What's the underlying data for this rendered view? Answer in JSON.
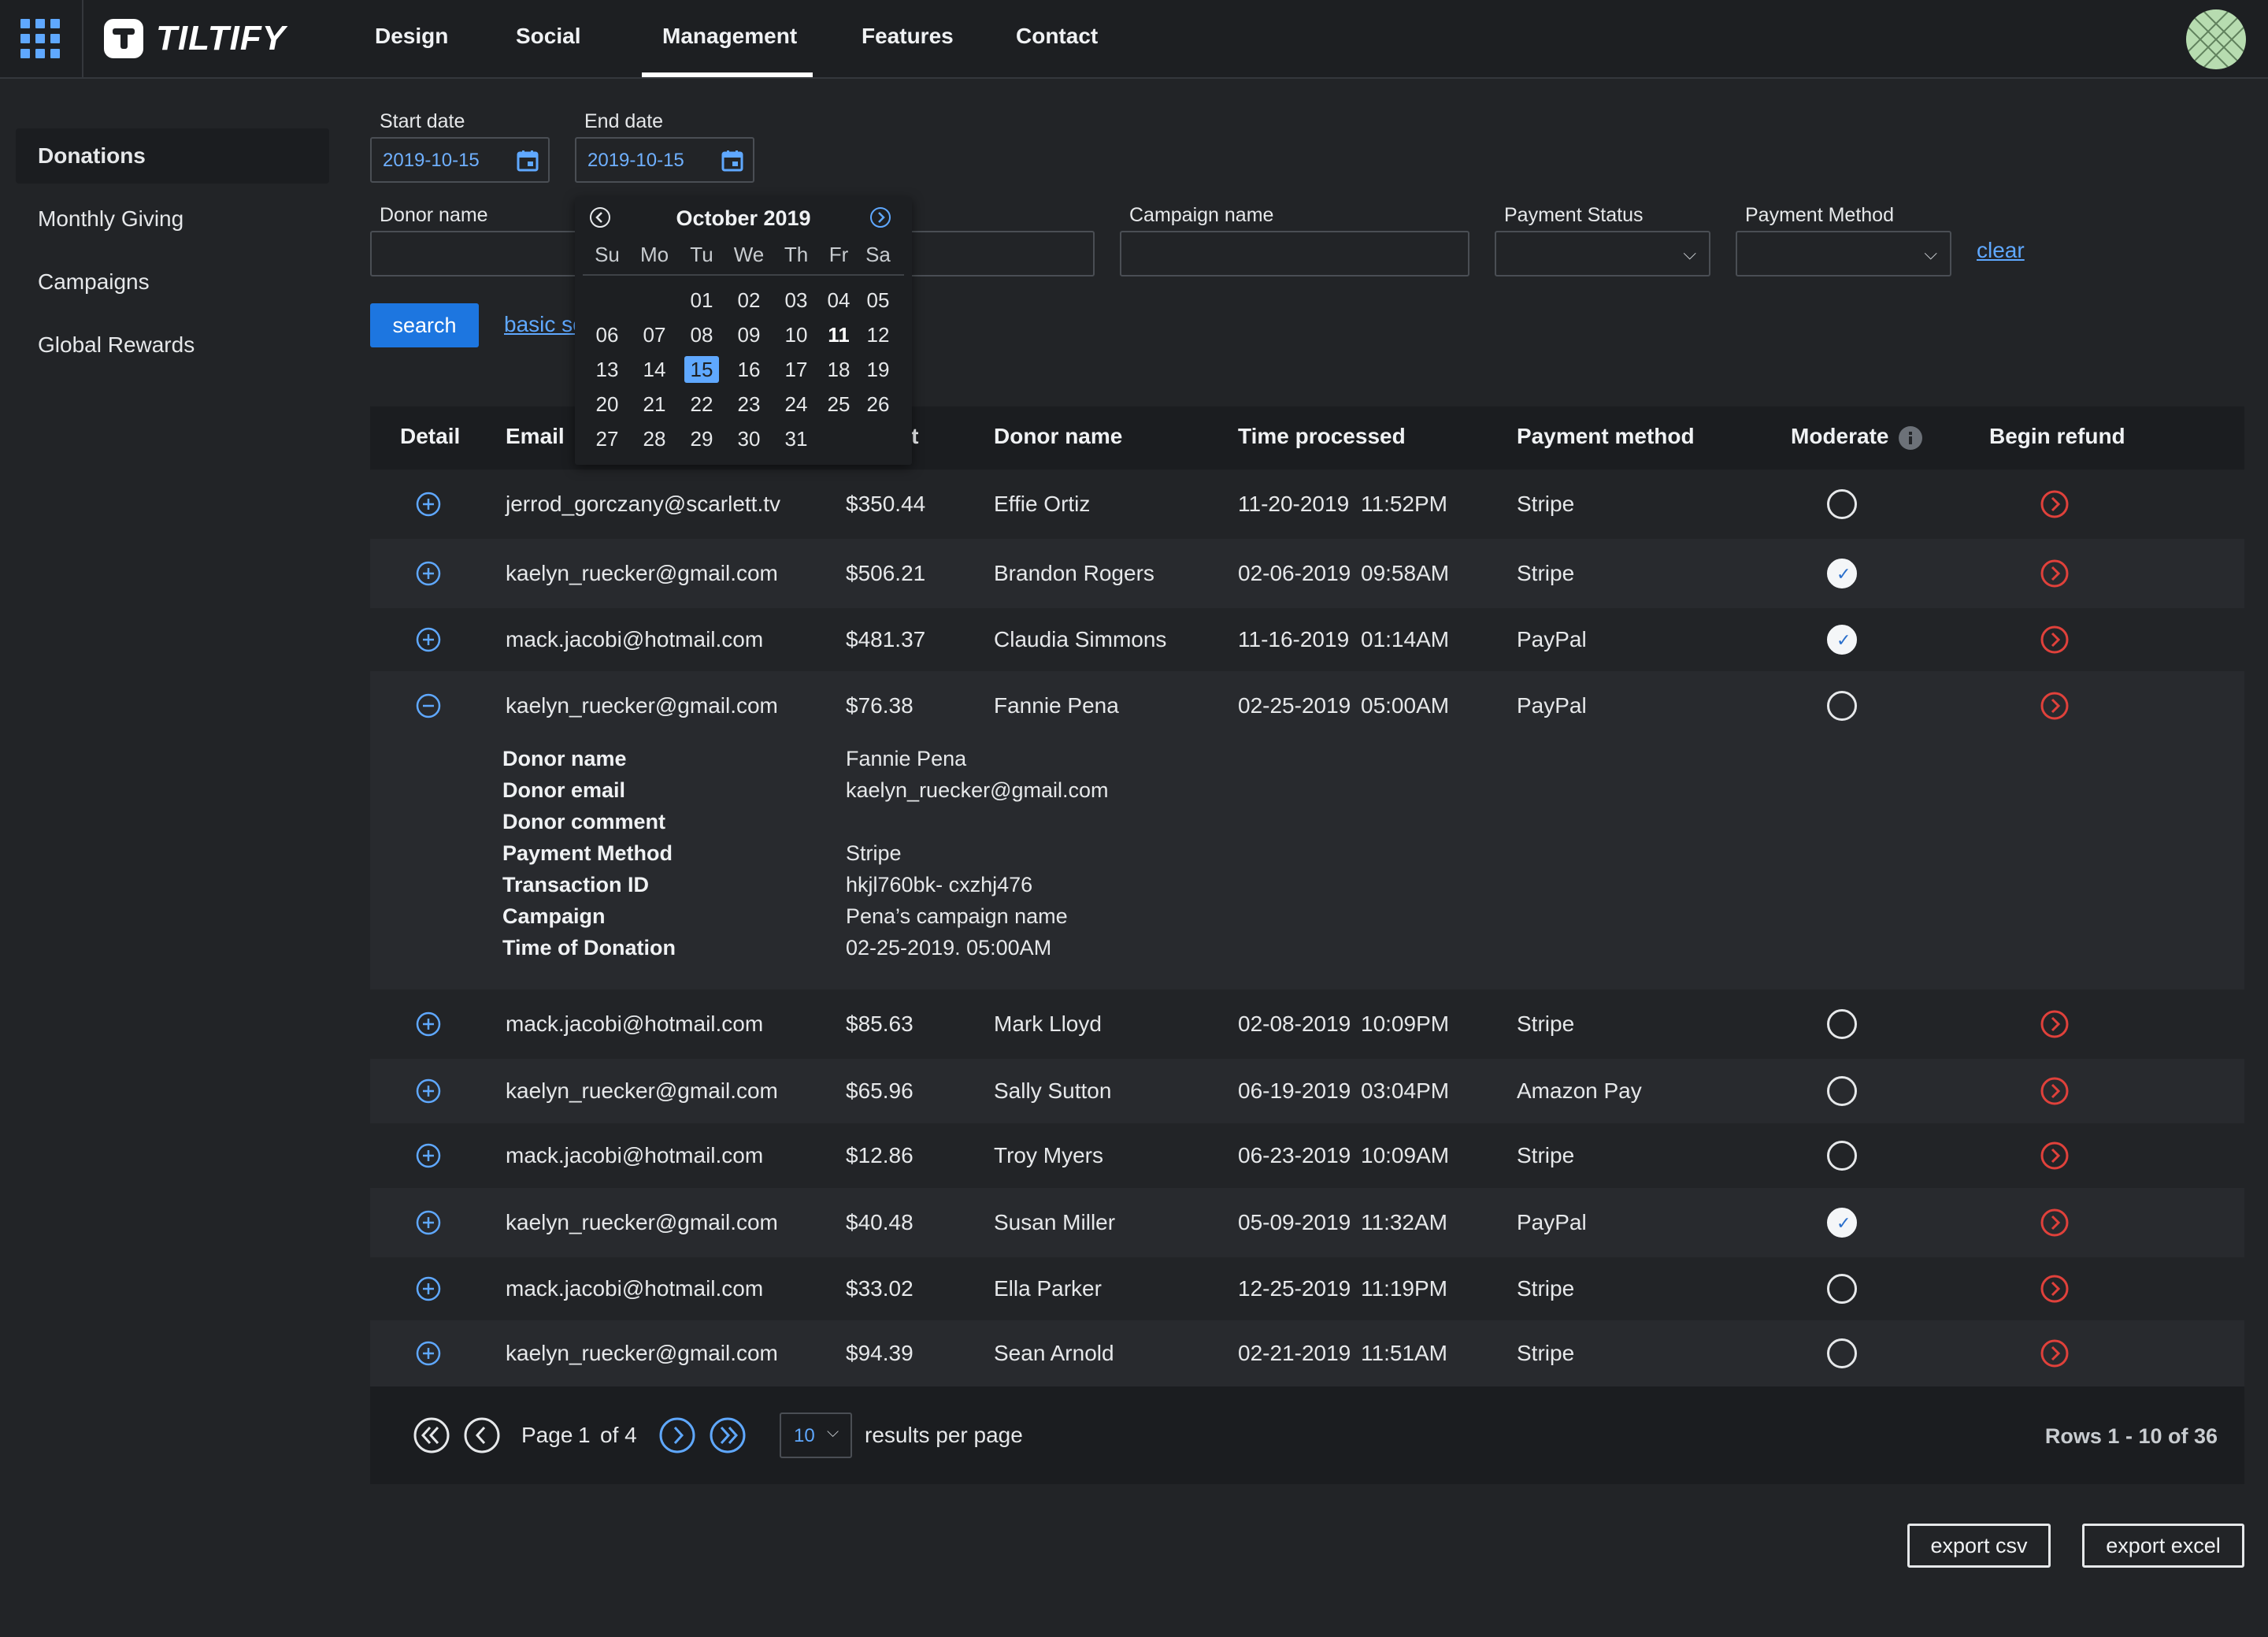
{
  "brand": {
    "name": "TILTIFY"
  },
  "nav": {
    "items": [
      "Design",
      "Social",
      "Management",
      "Features",
      "Contact"
    ],
    "active": "Management"
  },
  "sidebar": {
    "items": [
      "Donations",
      "Monthly Giving",
      "Campaigns",
      "Global Rewards"
    ],
    "active": "Donations"
  },
  "filters": {
    "start_date_label": "Start date",
    "start_date_value": "2019-10-15",
    "end_date_label": "End date",
    "end_date_value": "2019-10-15",
    "donor_name_label": "Donor name",
    "campaign_name_label": "Campaign name",
    "payment_status_label": "Payment Status",
    "payment_method_label": "Payment Method",
    "clear_label": "clear",
    "search_label": "search",
    "basic_search_label": "basic se"
  },
  "calendar": {
    "title": "October 2019",
    "weekdays": [
      "Su",
      "Mo",
      "Tu",
      "We",
      "Th",
      "Fr",
      "Sa"
    ],
    "weeks": [
      [
        "",
        "",
        "01",
        "02",
        "03",
        "04",
        "05"
      ],
      [
        "06",
        "07",
        "08",
        "09",
        "10",
        "11",
        "12"
      ],
      [
        "13",
        "14",
        "15",
        "16",
        "17",
        "18",
        "19"
      ],
      [
        "20",
        "21",
        "22",
        "23",
        "24",
        "25",
        "26"
      ],
      [
        "27",
        "28",
        "29",
        "30",
        "31",
        "",
        ""
      ]
    ],
    "today": "11",
    "selected": "15"
  },
  "table": {
    "headers": {
      "detail": "Detail",
      "email": "Email",
      "amount": "nt",
      "donor": "Donor name",
      "time": "Time processed",
      "method": "Payment method",
      "moderate": "Moderate",
      "refund": "Begin refund"
    },
    "rows": [
      {
        "email": "jerrod_gorczany@scarlett.tv",
        "amount": "$350.44",
        "donor": "Effie Ortiz",
        "date": "11-20-2019",
        "time": "11:52PM",
        "method": "Stripe",
        "moderated": false,
        "expanded": false
      },
      {
        "email": "kaelyn_ruecker@gmail.com",
        "amount": "$506.21",
        "donor": "Brandon Rogers",
        "date": "02-06-2019",
        "time": "09:58AM",
        "method": "Stripe",
        "moderated": true,
        "expanded": false
      },
      {
        "email": "mack.jacobi@hotmail.com",
        "amount": "$481.37",
        "donor": "Claudia Simmons",
        "date": "11-16-2019",
        "time": "01:14AM",
        "method": "PayPal",
        "moderated": true,
        "expanded": false
      },
      {
        "email": "kaelyn_ruecker@gmail.com",
        "amount": "$76.38",
        "donor": "Fannie Pena",
        "date": "02-25-2019",
        "time": "05:00AM",
        "method": "PayPal",
        "moderated": false,
        "expanded": true
      },
      {
        "email": "mack.jacobi@hotmail.com",
        "amount": "$85.63",
        "donor": "Mark Lloyd",
        "date": "02-08-2019",
        "time": "10:09PM",
        "method": "Stripe",
        "moderated": false,
        "expanded": false
      },
      {
        "email": "kaelyn_ruecker@gmail.com",
        "amount": "$65.96",
        "donor": "Sally Sutton",
        "date": "06-19-2019",
        "time": "03:04PM",
        "method": "Amazon Pay",
        "moderated": false,
        "expanded": false
      },
      {
        "email": "mack.jacobi@hotmail.com",
        "amount": "$12.86",
        "donor": "Troy Myers",
        "date": "06-23-2019",
        "time": "10:09AM",
        "method": "Stripe",
        "moderated": false,
        "expanded": false
      },
      {
        "email": "kaelyn_ruecker@gmail.com",
        "amount": "$40.48",
        "donor": "Susan Miller",
        "date": "05-09-2019",
        "time": "11:32AM",
        "method": "PayPal",
        "moderated": true,
        "expanded": false
      },
      {
        "email": "mack.jacobi@hotmail.com",
        "amount": "$33.02",
        "donor": "Ella Parker",
        "date": "12-25-2019",
        "time": "11:19PM",
        "method": "Stripe",
        "moderated": false,
        "expanded": false
      },
      {
        "email": "kaelyn_ruecker@gmail.com",
        "amount": "$94.39",
        "donor": "Sean Arnold",
        "date": "02-21-2019",
        "time": "11:51AM",
        "method": "Stripe",
        "moderated": false,
        "expanded": false
      }
    ],
    "expanded_detail": [
      {
        "label": "Donor name",
        "value": "Fannie Pena"
      },
      {
        "label": "Donor email",
        "value": "kaelyn_ruecker@gmail.com"
      },
      {
        "label": "Donor comment",
        "value": ""
      },
      {
        "label": "Payment Method",
        "value": "Stripe"
      },
      {
        "label": "Transaction ID",
        "value": "hkjl760bk- cxzhj476"
      },
      {
        "label": "Campaign",
        "value": "Pena’s campaign name"
      },
      {
        "label": "Time of Donation",
        "value": "02-25-2019. 05:00AM"
      }
    ]
  },
  "pagination": {
    "page_label": "Page",
    "page": "1",
    "of_label": "of 4",
    "per_page": "10",
    "per_page_label": "results per page",
    "rows_summary": "Rows 1 - 10 of 36"
  },
  "export": {
    "csv_label": "export csv",
    "excel_label": "export excel"
  },
  "colors": {
    "accent": "#5fa8ff",
    "primary_button": "#1d76e0",
    "refund": "#e0413b",
    "background": "#222427"
  }
}
